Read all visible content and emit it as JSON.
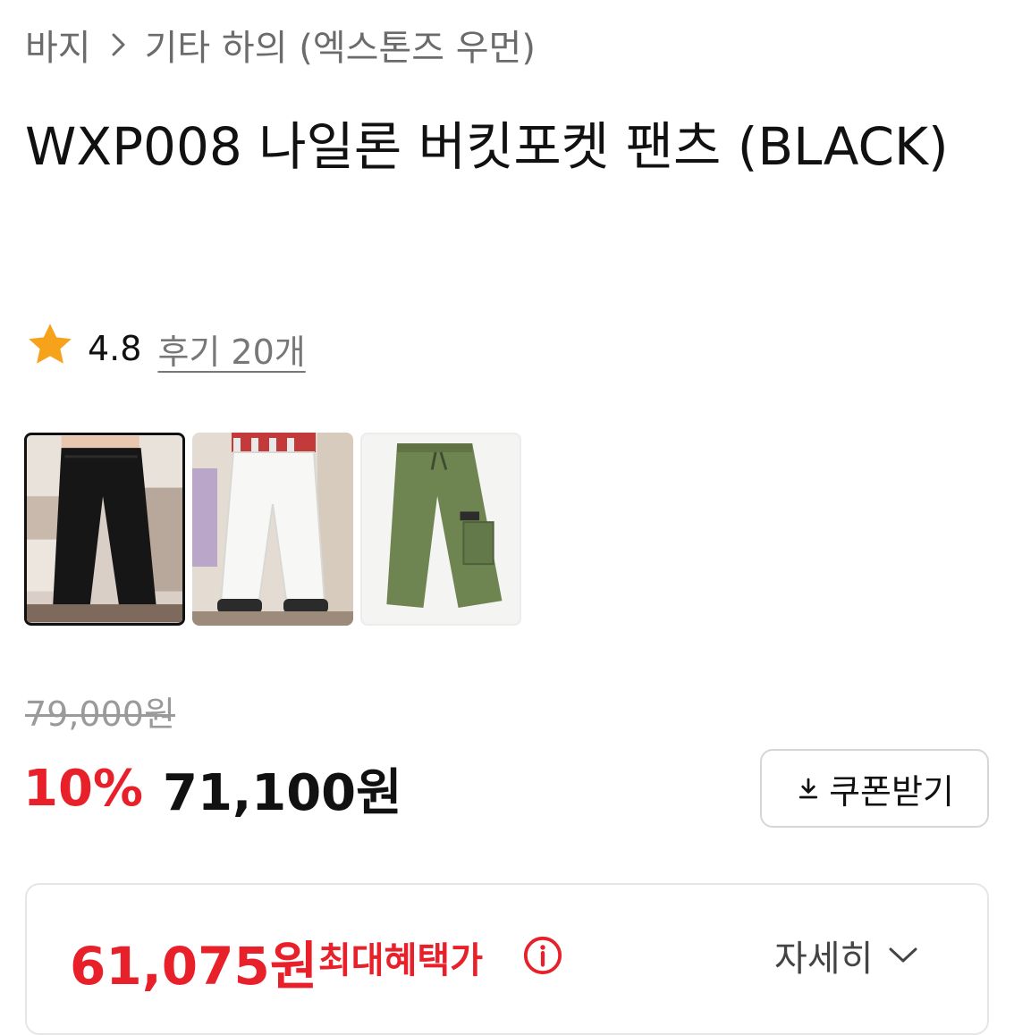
{
  "breadcrumb": {
    "category": "바지",
    "subcategory": "기타 하의 (엑스톤즈 우먼)"
  },
  "product": {
    "title": "WXP008 나일론 버킷포켓 팬츠 (BLACK)"
  },
  "rating": {
    "score": "4.8",
    "reviews_label": "후기 20개",
    "star_color": "#f7a21b"
  },
  "thumbnails": [
    {
      "icon": "black-pants-photo",
      "selected": true
    },
    {
      "icon": "white-pants-photo",
      "selected": false
    },
    {
      "icon": "khaki-pants-photo",
      "selected": false
    }
  ],
  "pricing": {
    "original_price": "79,000원",
    "discount_rate": "10%",
    "sale_price": "71,100원",
    "coupon_button_label": "쿠폰받기"
  },
  "benefit": {
    "max_benefit_price": "61,075원",
    "max_benefit_label": "최대혜택가",
    "details_label": "자세히"
  },
  "colors": {
    "accent_red": "#e8202a",
    "muted_text": "#6b6b6b"
  }
}
